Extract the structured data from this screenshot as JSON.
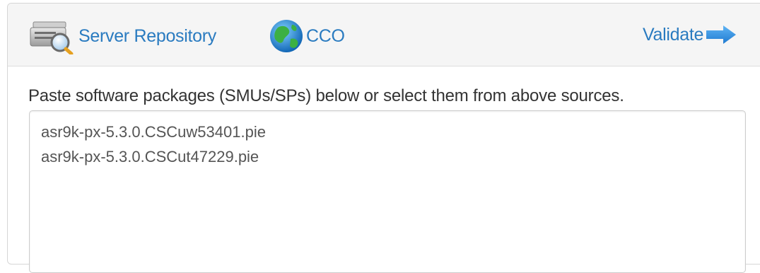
{
  "toolbar": {
    "sources": [
      {
        "label": "Server Repository",
        "icon": "server-repository-icon"
      },
      {
        "label": "CCO",
        "icon": "globe-icon"
      }
    ],
    "validate_label": "Validate",
    "validate_icon": "arrow-right-icon"
  },
  "main": {
    "instruction": "Paste software packages (SMUs/SPs) below or select them from above sources.",
    "packages": [
      "asr9k-px-5.3.0.CSCuw53401.pie",
      "asr9k-px-5.3.0.CSCut47229.pie"
    ]
  },
  "colors": {
    "link": "#2a7bc0",
    "toolbar_bg": "#f5f5f5",
    "text": "#333333",
    "arrow": "#2f8fe0"
  }
}
